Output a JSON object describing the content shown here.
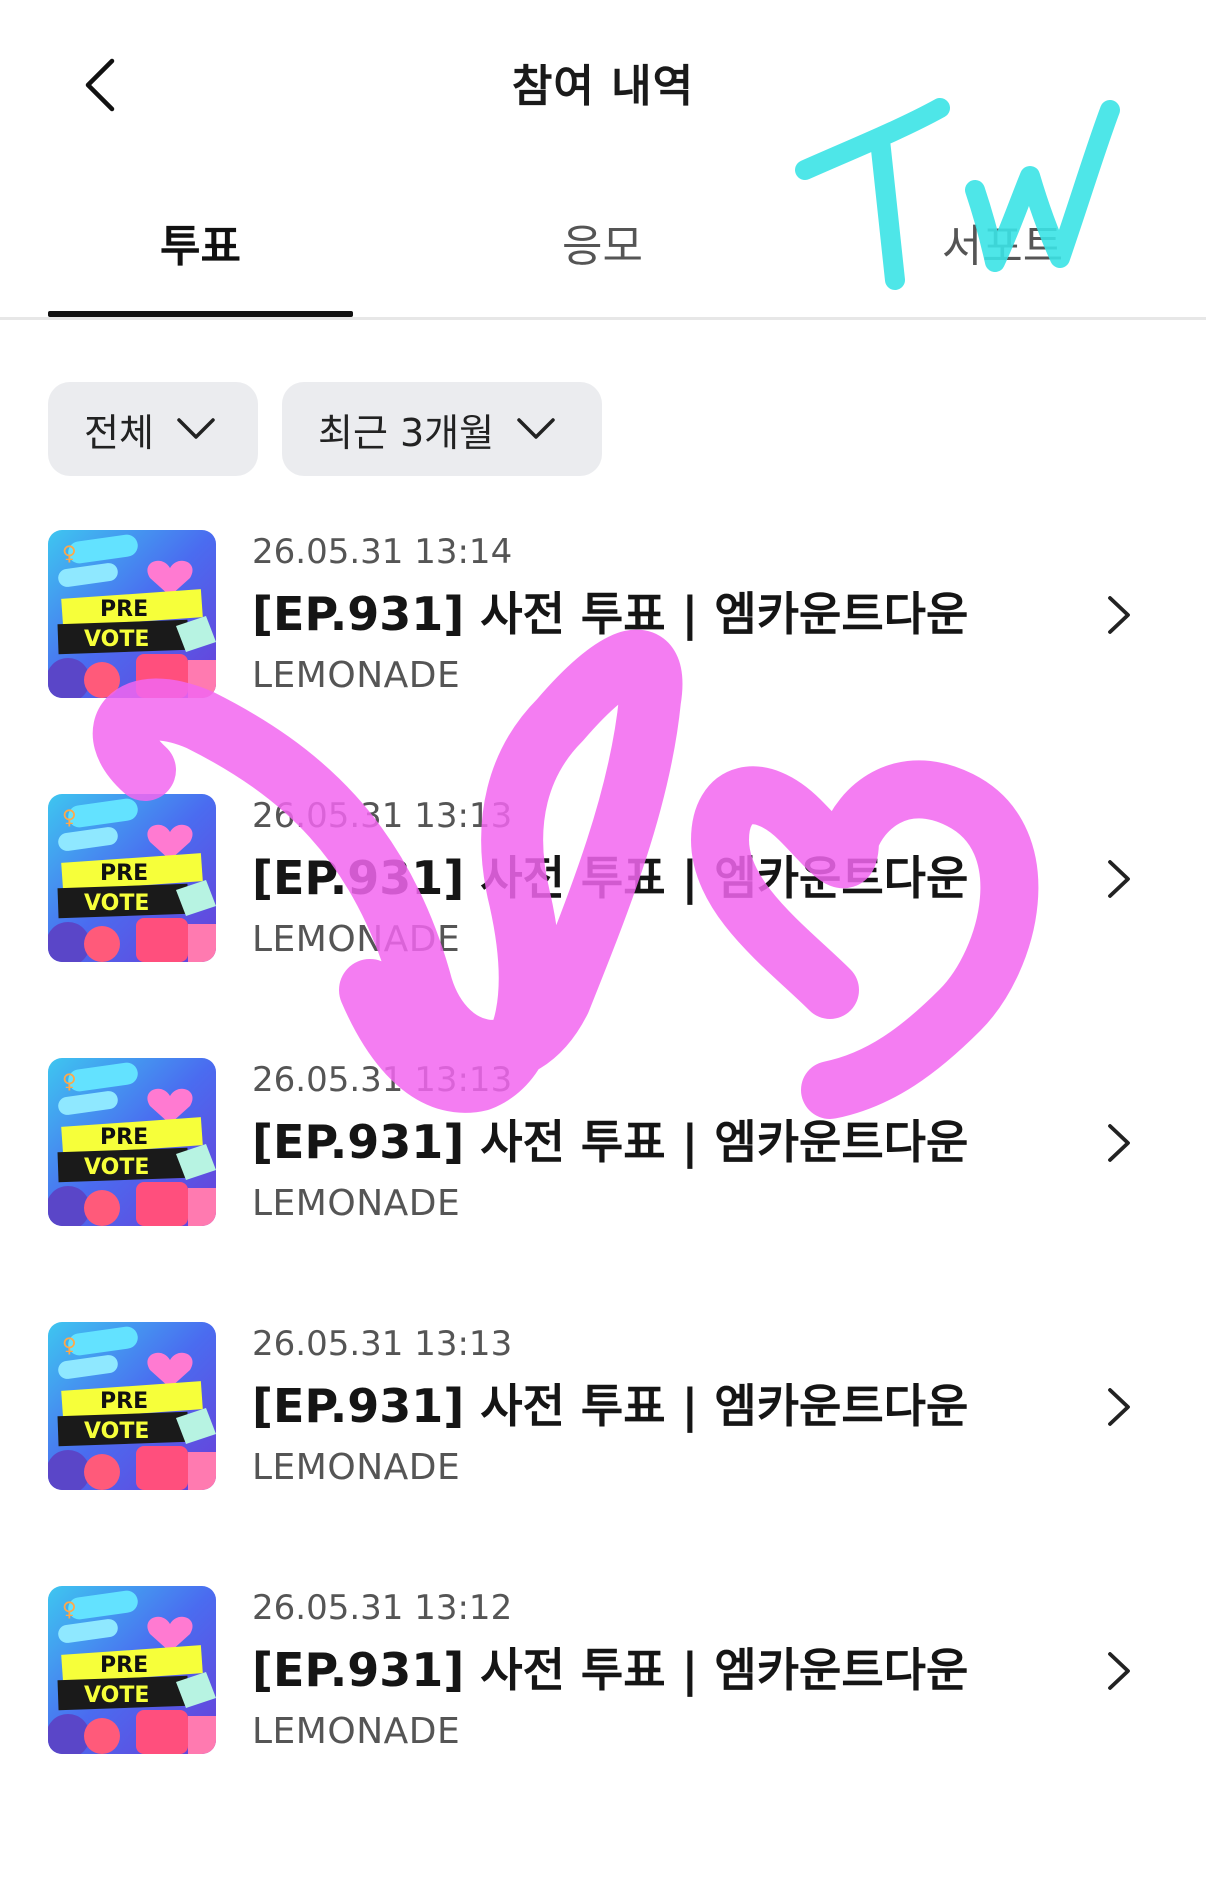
{
  "header": {
    "title": "참여 내역",
    "back_icon": "chevron-left-icon"
  },
  "tabs": [
    {
      "label": "투표",
      "active": true
    },
    {
      "label": "응모",
      "active": false
    },
    {
      "label": "서포트",
      "active": false
    }
  ],
  "filters": {
    "type": {
      "label": "전체",
      "icon": "chevron-down-icon"
    },
    "period": {
      "label": "최근 3개월",
      "icon": "chevron-down-icon"
    }
  },
  "thumbnail": {
    "line1": "PRE",
    "line2": "VOTE"
  },
  "items": [
    {
      "date": "26.05.31 13:14",
      "title": "[EP.931] 사전 투표 | 엠카운트다운",
      "artist": "LEMONADE"
    },
    {
      "date": "26.05.31 13:13",
      "title": "[EP.931] 사전 투표 | 엠카운트다운",
      "artist": "LEMONADE"
    },
    {
      "date": "26.05.31 13:13",
      "title": "[EP.931] 사전 투표 | 엠카운트다운",
      "artist": "LEMONADE"
    },
    {
      "date": "26.05.31 13:13",
      "title": "[EP.931] 사전 투표 | 엠카운트다운",
      "artist": "LEMONADE"
    },
    {
      "date": "26.05.31 13:12",
      "title": "[EP.931] 사전 투표 | 엠카운트다운",
      "artist": "LEMONADE"
    }
  ],
  "colors": {
    "doodle_pink": "#f266f0",
    "doodle_cyan": "#3be3e6",
    "chip_bg": "#ebecef"
  }
}
